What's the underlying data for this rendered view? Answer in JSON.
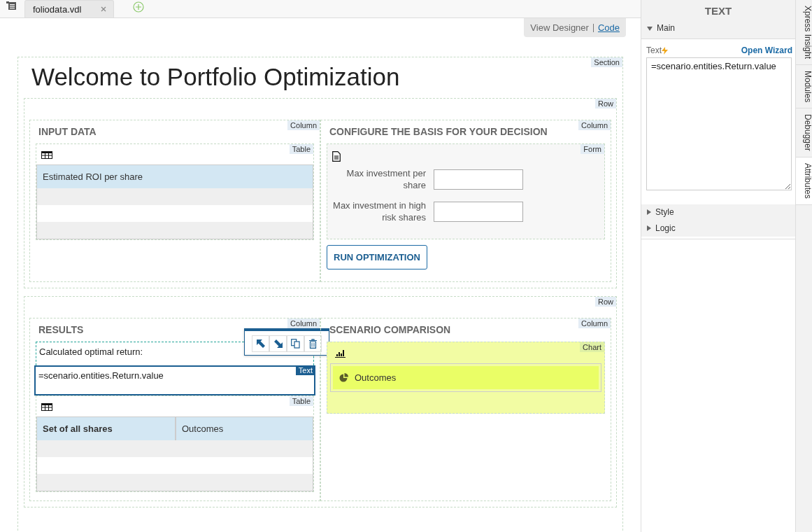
{
  "file_tabs": [
    {
      "label": "foliodata.vdl",
      "selected": true
    }
  ],
  "view_switch": [
    {
      "label": "View Designer",
      "selected": true
    },
    {
      "label": "Code",
      "selected": false
    }
  ],
  "section": {
    "tag": "Section",
    "title": "Welcome to Portfolio Optimization",
    "rows": [
      {
        "tag": "Row",
        "columns": [
          {
            "tag": "Column",
            "heading": "INPUT DATA",
            "items": [
              {
                "kind": "table",
                "tag": "Table",
                "columns": [
                  {
                    "label": "Estimated ROI per share",
                    "bold": false
                  }
                ]
              }
            ]
          },
          {
            "tag": "Column",
            "heading": "CONFIGURE THE BASIS FOR YOUR DECISION",
            "items": [
              {
                "kind": "form",
                "tag": "Form",
                "fields": [
                  {
                    "label": "Max investment per share"
                  },
                  {
                    "label": "Max investment in high risk shares"
                  }
                ]
              },
              {
                "kind": "button",
                "label": "RUN OPTIMIZATION"
              }
            ]
          }
        ]
      },
      {
        "tag": "Row",
        "columns": [
          {
            "tag": "Column",
            "heading": "RESULTS",
            "items": [
              {
                "kind": "text",
                "text": "Calculated optimal return:",
                "selected": false
              },
              {
                "kind": "text",
                "text": "=scenario.entities.Return.value",
                "selected": true,
                "tag": "Text"
              },
              {
                "kind": "table",
                "tag": "Table",
                "columns": [
                  {
                    "label": "Set of all shares",
                    "bold": true
                  },
                  {
                    "label": "Outcomes",
                    "bold": false
                  }
                ]
              }
            ]
          },
          {
            "tag": "Column",
            "heading": "SCENARIO COMPARISON",
            "items": [
              {
                "kind": "chart",
                "tag": "Chart",
                "series": [
                  {
                    "label": "Outcomes"
                  }
                ]
              }
            ]
          }
        ]
      }
    ]
  },
  "panel": {
    "title": "TEXT",
    "groups": [
      {
        "label": "Main",
        "expanded": true
      },
      {
        "label": "Style",
        "expanded": false
      },
      {
        "label": "Logic",
        "expanded": false
      }
    ],
    "field_label": "Text",
    "wizard_link": "Open Wizard",
    "value": "=scenario.entities.Return.value"
  },
  "side_tabs": [
    {
      "label": "Xpress Insight",
      "selected": false
    },
    {
      "label": "Modules",
      "selected": false
    },
    {
      "label": "Debugger",
      "selected": false
    },
    {
      "label": "Attributes",
      "selected": true
    }
  ]
}
